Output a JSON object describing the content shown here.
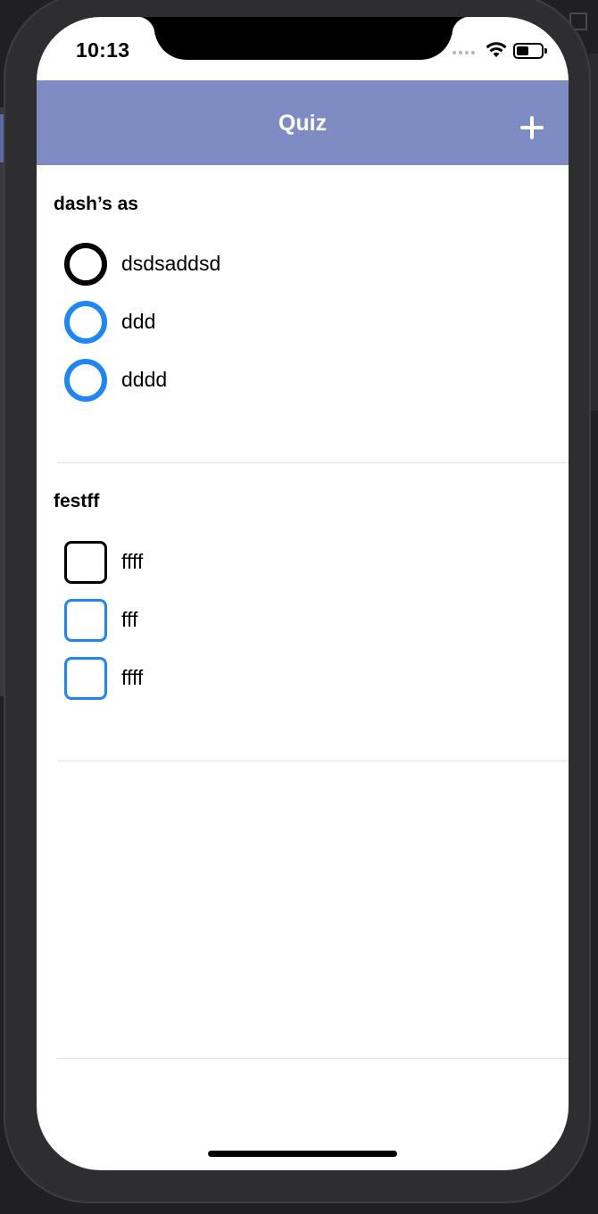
{
  "status_bar": {
    "time": "10:13"
  },
  "navbar": {
    "title": "Quiz",
    "add_icon": "plus-icon",
    "background_color": "#7f8bc3"
  },
  "questions": [
    {
      "title": "dash’s as",
      "type": "single-choice",
      "options": [
        {
          "label": "dsdsaddsd",
          "active": true
        },
        {
          "label": "ddd",
          "active": false
        },
        {
          "label": "dddd",
          "active": false
        }
      ]
    },
    {
      "title": "festff",
      "type": "multiple-choice",
      "options": [
        {
          "label": "ffff",
          "active": true
        },
        {
          "label": "fff",
          "active": false
        },
        {
          "label": "ffff",
          "active": false
        }
      ]
    }
  ],
  "colors": {
    "accent": "#1e86f5",
    "active_outline": "#000000"
  }
}
